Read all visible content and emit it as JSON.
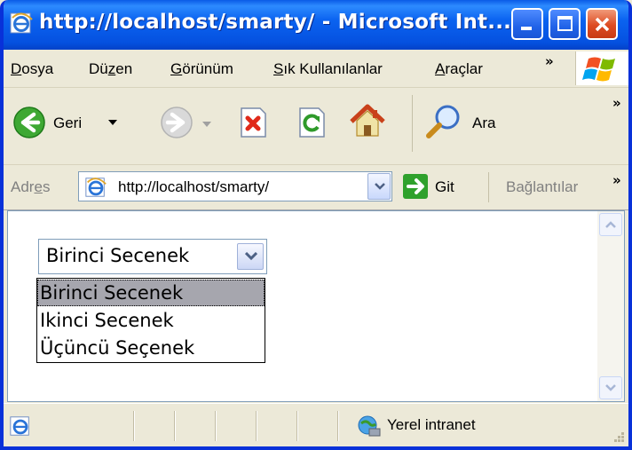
{
  "window": {
    "title": "http://localhost/smarty/ - Microsoft Int..."
  },
  "menu": {
    "items": [
      {
        "pre": "",
        "u": "D",
        "post": "osya"
      },
      {
        "pre": "Dü",
        "u": "z",
        "post": "en"
      },
      {
        "pre": "",
        "u": "G",
        "post": "örünüm"
      },
      {
        "pre": "",
        "u": "S",
        "post": "ık Kullanılanlar"
      },
      {
        "pre": "",
        "u": "A",
        "post": "raçlar"
      }
    ],
    "more": "»"
  },
  "toolbar": {
    "back_label": "Geri",
    "search_label": "Ara",
    "more": "»"
  },
  "address": {
    "label_pre": "Adr",
    "label_u": "e",
    "label_post": "s",
    "url": "http://localhost/smarty/",
    "go_label": "Git",
    "links_label": "Bağlantılar",
    "more": "»"
  },
  "page": {
    "select": {
      "selected": "Birinci Secenek",
      "options": [
        "Birinci Secenek",
        "Ikinci Secenek",
        "Üçüncü Seçenek"
      ]
    }
  },
  "status": {
    "zone": "Yerel intranet"
  }
}
